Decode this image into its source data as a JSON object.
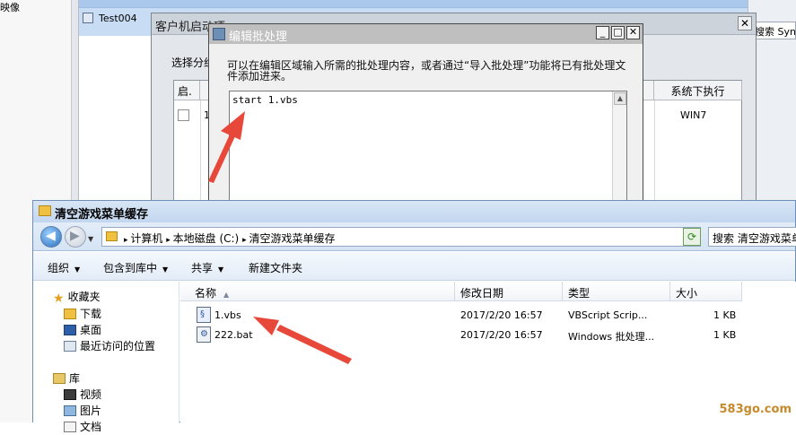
{
  "background": {
    "left_text": "映像",
    "row_name": "Test004",
    "search_label": "搜索 Syn"
  },
  "client_dialog": {
    "title": "客户机启动项",
    "label": "选择分组",
    "close": "✕",
    "columns": [
      "启.",
      "",
      "系统下执行"
    ],
    "row": {
      "col2": "1",
      "system": "WIN7"
    }
  },
  "edit_dialog": {
    "title": "编辑批处理",
    "buttons": {
      "minimize": "_",
      "maximize": "□",
      "close": "✕"
    },
    "description": "可以在编辑区域输入所需的批处理内容，或者通过“导入批处理”功能将已有批处理文件添加进来。",
    "content": "start 1.vbs"
  },
  "explorer": {
    "title": "清空游戏菜单缓存",
    "breadcrumb": [
      "计算机",
      "本地磁盘 (C:)",
      "清空游戏菜单缓存"
    ],
    "search_placeholder": "搜索 清空游戏菜单缓存",
    "toolbar": {
      "organize": "组织",
      "include": "包含到库中",
      "share": "共享",
      "new_folder": "新建文件夹"
    },
    "nav": [
      {
        "label": "收藏夹",
        "icon": "star-icon"
      },
      {
        "label": "下载",
        "icon": "download-folder-icon"
      },
      {
        "label": "桌面",
        "icon": "desktop-icon"
      },
      {
        "label": "最近访问的位置",
        "icon": "recent-places-icon"
      },
      {
        "label": "库",
        "icon": "library-icon"
      },
      {
        "label": "视频",
        "icon": "video-icon"
      },
      {
        "label": "图片",
        "icon": "pictures-icon"
      },
      {
        "label": "文档",
        "icon": "documents-icon"
      }
    ],
    "columns": {
      "name": "名称",
      "modified": "修改日期",
      "type": "类型",
      "size": "大小"
    },
    "files": [
      {
        "name": "1.vbs",
        "modified": "2017/2/20 16:57",
        "type": "VBScript Scrip...",
        "size": "1 KB"
      },
      {
        "name": "222.bat",
        "modified": "2017/2/20 16:57",
        "type": "Windows 批处理...",
        "size": "1 KB"
      }
    ]
  },
  "watermark": "583go.com",
  "colors": {
    "arrow": "#e8483a",
    "title_bar_active": "#c2d6ef"
  }
}
